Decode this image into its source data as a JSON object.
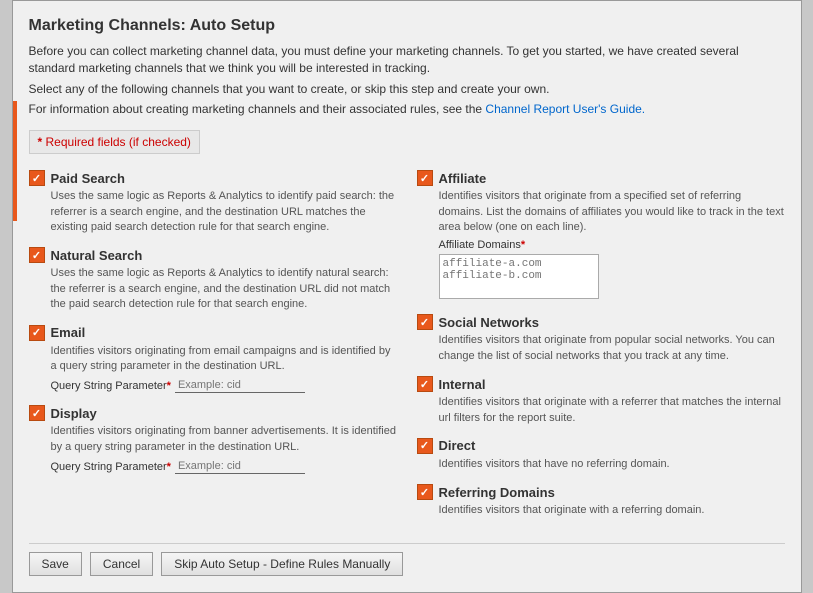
{
  "page": {
    "title": "Marketing Channels: Auto Setup",
    "intro1": "Before you can collect marketing channel data, you must define your marketing channels. To get you started, we have created several standard marketing channels that we think you will be interested in tracking.",
    "intro2": "Select any of the following channels that you want to create, or skip this step and create your own.",
    "intro3_prefix": "For information about creating marketing channels and their associated rules, see the ",
    "intro3_link": "Channel Report User's Guide.",
    "required_label": "* Required fields (if checked)"
  },
  "channels_left": [
    {
      "id": "paid-search",
      "title": "Paid Search",
      "desc": "Uses the same logic as Reports & Analytics to identify paid search: the referrer is a search engine, and the destination URL matches the existing paid search detection rule for that search engine.",
      "checked": true,
      "has_field": false
    },
    {
      "id": "natural-search",
      "title": "Natural Search",
      "desc": "Uses the same logic as Reports & Analytics to identify natural search: the referrer is a search engine, and the destination URL did not match the paid search detection rule for that search engine.",
      "checked": true,
      "has_field": false
    },
    {
      "id": "email",
      "title": "Email",
      "desc": "Identifies visitors originating from email campaigns and is identified by a query string parameter in the destination URL.",
      "checked": true,
      "has_field": true,
      "field_label": "Query String Parameter",
      "field_placeholder": "Example: cid"
    },
    {
      "id": "display",
      "title": "Display",
      "desc": "Identifies visitors originating from banner advertisements. It is identified by a query string parameter in the destination URL.",
      "checked": true,
      "has_field": true,
      "field_label": "Query String Parameter",
      "field_placeholder": "Example: cid"
    }
  ],
  "channels_right": [
    {
      "id": "affiliate",
      "title": "Affiliate",
      "desc": "Identifies visitors that originate from a specified set of referring domains. List the domains of affiliates you would like to track in the text area below (one on each line).",
      "checked": true,
      "has_textarea": true,
      "textarea_label": "Affiliate Domains",
      "textarea_placeholder": "affiliate-a.com\naffiliate-b.com"
    },
    {
      "id": "social-networks",
      "title": "Social Networks",
      "desc": "Identifies visitors that originate from popular social networks. You can change the list of social networks that you track at any time.",
      "checked": true,
      "has_textarea": false
    },
    {
      "id": "internal",
      "title": "Internal",
      "desc": "Identifies visitors that originate with a referrer that matches the internal url filters for the report suite.",
      "checked": true,
      "has_textarea": false
    },
    {
      "id": "direct",
      "title": "Direct",
      "desc": "Identifies visitors that have no referring domain.",
      "checked": true,
      "has_textarea": false
    },
    {
      "id": "referring-domains",
      "title": "Referring Domains",
      "desc": "Identifies visitors that originate with a referring domain.",
      "checked": true,
      "has_textarea": false
    }
  ],
  "buttons": {
    "save": "Save",
    "cancel": "Cancel",
    "skip": "Skip Auto Setup - Define Rules Manually"
  }
}
